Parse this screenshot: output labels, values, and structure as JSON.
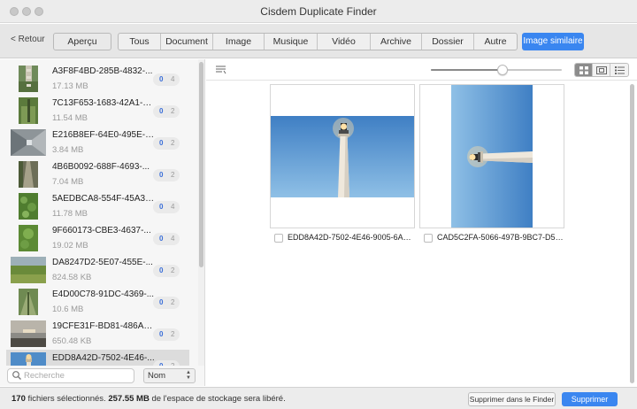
{
  "app": {
    "title": "Cisdem Duplicate Finder"
  },
  "toolbar": {
    "back_label": "< Retour",
    "preview_label": "Aperçu",
    "categories": [
      "Tous",
      "Document",
      "Image",
      "Musique",
      "Vidéo",
      "Archive",
      "Dossier",
      "Autre"
    ],
    "similar_label": "Image similaire"
  },
  "sidebar": {
    "items": [
      {
        "name": "A3F8F4BD-285B-4832-...",
        "size": "17.13 MB",
        "count_a": "0",
        "count_b": "4"
      },
      {
        "name": "7C13F653-1683-42A1-9...",
        "size": "11.54 MB",
        "count_a": "0",
        "count_b": "2"
      },
      {
        "name": "E216B8EF-64E0-495E-8...",
        "size": "3.84 MB",
        "count_a": "0",
        "count_b": "2"
      },
      {
        "name": "4B6B0092-688F-4693-...",
        "size": "7.04 MB",
        "count_a": "0",
        "count_b": "2"
      },
      {
        "name": "5AEDBCA8-554F-45A3-...",
        "size": "11.78 MB",
        "count_a": "0",
        "count_b": "4"
      },
      {
        "name": "9F660173-CBE3-4637-...",
        "size": "19.02 MB",
        "count_a": "0",
        "count_b": "4"
      },
      {
        "name": "DA8247D2-5E07-455E-...",
        "size": "824.58 KB",
        "count_a": "0",
        "count_b": "2"
      },
      {
        "name": "E4D00C78-91DC-4369-...",
        "size": "10.6 MB",
        "count_a": "0",
        "count_b": "2"
      },
      {
        "name": "19CFE31F-BD81-486A-B...",
        "size": "650.48 KB",
        "count_a": "0",
        "count_b": "2"
      },
      {
        "name": "EDD8A42D-7502-4E46-...",
        "size": "",
        "count_a": "0",
        "count_b": "2"
      }
    ],
    "search_placeholder": "Recherche",
    "sort_label": "Nom"
  },
  "main": {
    "zoom_level": 0.55,
    "view_mode": "grid",
    "images": [
      {
        "name": "EDD8A42D-7502-4E46-9005-6AA1F...",
        "checked": false
      },
      {
        "name": "CAD5C2FA-5066-497B-9BC7-D53D...",
        "checked": false
      }
    ]
  },
  "bottom": {
    "selected_count": "170",
    "status_part1": " fichiers sélectionnés. ",
    "freed_size": "257.55 MB",
    "status_part2": " de l'espace de stockage sera libéré.",
    "finder_label": "Supprimer dans le Finder",
    "delete_label": "Supprimer"
  },
  "colors": {
    "accent": "#3a86f0",
    "badge_blue": "#3a6ed8"
  }
}
